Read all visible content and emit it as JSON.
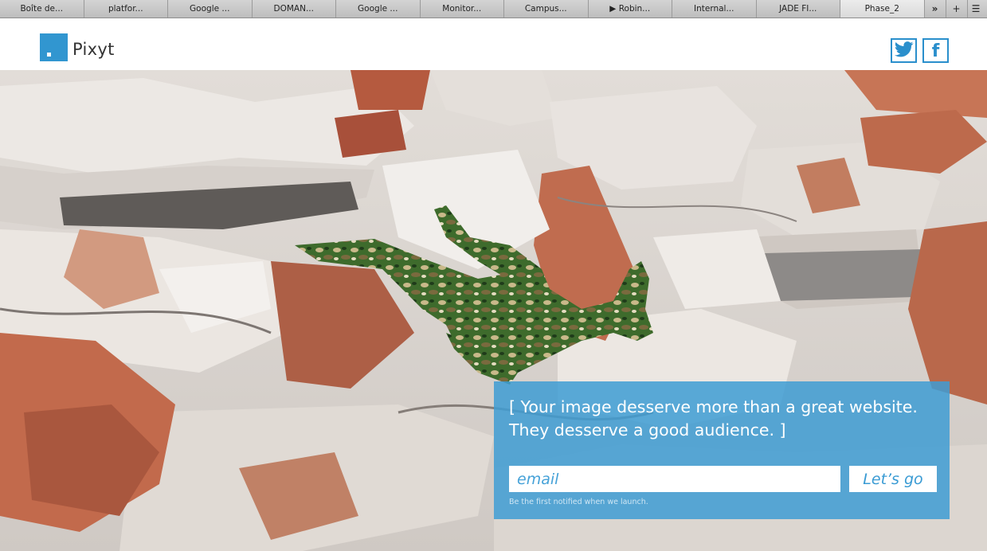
{
  "browser": {
    "tabs": [
      "Boîte de...",
      "platfor...",
      "Google ...",
      "DOMAN...",
      "Google ...",
      "Monitor...",
      "Campus...",
      "▶ Robin...",
      "Internal...",
      "JADE FI...",
      "Phase_2"
    ],
    "overflow_glyph": "»",
    "new_tab_glyph": "+",
    "list_glyph": "☰"
  },
  "header": {
    "logo_text": "Pixyt",
    "brand_color": "#3196d0",
    "social": [
      {
        "icon": "twitter-icon"
      },
      {
        "icon": "facebook-icon",
        "glyph": "f"
      }
    ]
  },
  "hero": {
    "image": "camouflage-painted-body-on-rock-wall"
  },
  "signup": {
    "tagline_line1": "[ Your image desserve more than a great website.",
    "tagline_line2": "They desserve a good audience. ]",
    "email_placeholder": "email",
    "button_label": "Let’s go",
    "note": "Be the first notified when we launch."
  }
}
